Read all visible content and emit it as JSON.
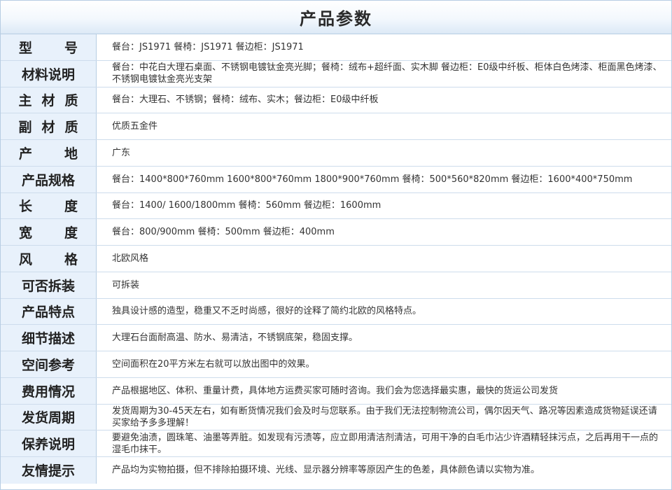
{
  "title": "产品参数",
  "rows": [
    {
      "label": [
        "型",
        "号"
      ],
      "value": "餐台：JS1971  餐椅：JS1971  餐边柜：JS1971"
    },
    {
      "label": [
        "材料说明"
      ],
      "value": "餐台：中花白大理石桌面、不锈钢电镀钛金亮光脚；餐椅：绒布+超纤面、实木脚  餐边柜：E0级中纤板、柜体白色烤漆、柜面黑色烤漆、不锈钢电镀钛金亮光支架"
    },
    {
      "label": [
        "主",
        "材",
        "质"
      ],
      "value": "餐台：大理石、不锈钢；餐椅：绒布、实木；餐边柜：E0级中纤板"
    },
    {
      "label": [
        "副",
        "材",
        "质"
      ],
      "value": "优质五金件"
    },
    {
      "label": [
        "产",
        "地"
      ],
      "value": "广东"
    },
    {
      "label": [
        "产品规格"
      ],
      "value": "餐台：1400*800*760mm 1600*800*760mm 1800*900*760mm  餐椅：500*560*820mm  餐边柜：1600*400*750mm"
    },
    {
      "label": [
        "长",
        "度"
      ],
      "value": "餐台：1400/ 1600/1800mm  餐椅：560mm  餐边柜：1600mm"
    },
    {
      "label": [
        "宽",
        "度"
      ],
      "value": "餐台：800/900mm  餐椅：500mm  餐边柜：400mm"
    },
    {
      "label": [
        "风",
        "格"
      ],
      "value": "北欧风格"
    },
    {
      "label": [
        "可否拆装"
      ],
      "value": "可拆装"
    },
    {
      "label": [
        "产品特点"
      ],
      "value": "独具设计感的造型，稳重又不乏时尚感，很好的诠释了简约北欧的风格特点。"
    },
    {
      "label": [
        "细节描述"
      ],
      "value": "大理石台面耐高温、防水、易清洁，不锈钢底架，稳固支撑。"
    },
    {
      "label": [
        "空间参考"
      ],
      "value": "空间面积在20平方米左右就可以放出图中的效果。"
    },
    {
      "label": [
        "费用情况"
      ],
      "value": "产品根据地区、体积、重量计费，具体地方运费买家可随时咨询。我们会为您选择最实惠，最快的货运公司发货"
    },
    {
      "label": [
        "发货周期"
      ],
      "value": "发货周期为30-45天左右，如有断货情况我们会及时与您联系。由于我们无法控制物流公司，偶尔因天气、路况等因素造成货物延误还请买家给予多多理解！"
    },
    {
      "label": [
        "保养说明"
      ],
      "value": "要避免油渍，圆珠笔、油墨等弄脏。如发现有污渍等，应立即用清洁剂清洁，可用干净的白毛巾沾少许酒精轻抹污点，之后再用干一点的湿毛巾抹干。"
    },
    {
      "label": [
        "友情提示"
      ],
      "value": "产品均为实物拍摄，但不排除拍摄环境、光线、显示器分辨率等原因产生的色差，具体颜色请以实物为准。"
    }
  ]
}
